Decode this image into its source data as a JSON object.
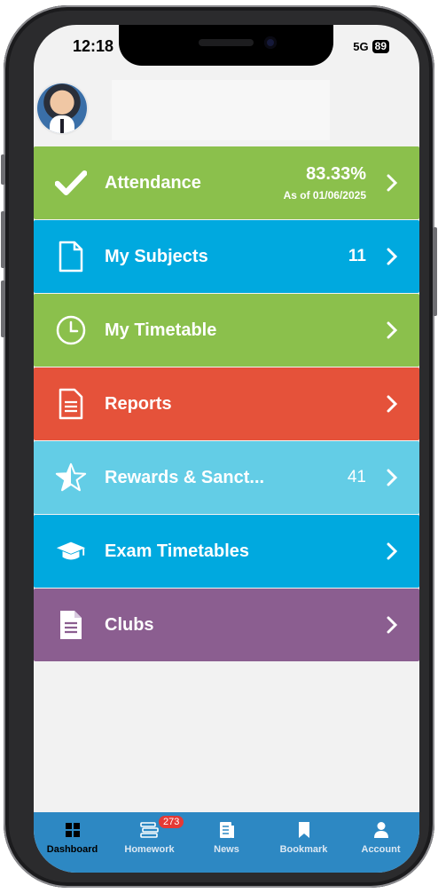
{
  "status_bar": {
    "time": "12:18",
    "network": "5G",
    "battery": "89"
  },
  "tiles": [
    {
      "key": "attendance",
      "label": "Attendance",
      "value": "83.33%",
      "sub": "As of 01/06/2025",
      "color": "#8bc04c",
      "icon": "check-icon"
    },
    {
      "key": "subjects",
      "label": "My Subjects",
      "value": "11",
      "color": "#00a9df",
      "icon": "document-icon"
    },
    {
      "key": "timetable",
      "label": "My Timetable",
      "color": "#8bc04c",
      "icon": "clock-icon"
    },
    {
      "key": "reports",
      "label": "Reports",
      "color": "#e5523a",
      "icon": "report-icon"
    },
    {
      "key": "rewards",
      "label": "Rewards & Sanct...",
      "value": "41",
      "color": "#63cde6",
      "icon": "star-icon"
    },
    {
      "key": "exams",
      "label": "Exam Timetables",
      "color": "#00a9df",
      "icon": "graduation-cap-icon"
    },
    {
      "key": "clubs",
      "label": "Clubs",
      "color": "#8b5e90",
      "icon": "file-icon"
    }
  ],
  "tab_bar": {
    "items": [
      {
        "label": "Dashboard",
        "icon": "grid-icon",
        "active": true
      },
      {
        "label": "Homework",
        "icon": "books-icon",
        "badge": "273"
      },
      {
        "label": "News",
        "icon": "newspaper-icon"
      },
      {
        "label": "Bookmark",
        "icon": "bookmark-icon"
      },
      {
        "label": "Account",
        "icon": "person-icon"
      }
    ]
  }
}
